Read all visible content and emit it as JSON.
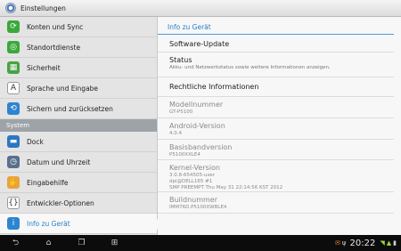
{
  "actionbar": {
    "title": "Einstellungen"
  },
  "sidebar": {
    "items_top": [
      {
        "label": "Konten und Sync",
        "icon": "sync-icon",
        "color": "#3aa83a",
        "glyph": "⟳"
      },
      {
        "label": "Standortdienste",
        "icon": "location-icon",
        "color": "#3aa83a",
        "glyph": "◎"
      },
      {
        "label": "Sicherheit",
        "icon": "security-grid-icon",
        "color": "#47a344",
        "glyph": "▦"
      },
      {
        "label": "Sprache und Eingabe",
        "icon": "language-icon",
        "color": "#ffffff",
        "glyph": "A"
      },
      {
        "label": "Sichern und zurücksetzen",
        "icon": "backup-icon",
        "color": "#2e84d0",
        "glyph": "⟲"
      }
    ],
    "section_header": "System",
    "items_bottom": [
      {
        "label": "Dock",
        "icon": "dock-icon",
        "color": "#2b78c0",
        "glyph": "▬"
      },
      {
        "label": "Datum und Uhrzeit",
        "icon": "clock-icon",
        "color": "#5a6f8c",
        "glyph": "◷"
      },
      {
        "label": "Eingabehilfe",
        "icon": "accessibility-hand-icon",
        "color": "#e9a33d",
        "glyph": "✋"
      },
      {
        "label": "Entwickler-Optionen",
        "icon": "developer-icon",
        "color": "#ffffff",
        "glyph": "{}"
      },
      {
        "label": "Info zu Gerät",
        "icon": "info-icon",
        "color": "#2e84d0",
        "glyph": "i"
      }
    ]
  },
  "content": {
    "header": "Info zu Gerät",
    "rows": [
      {
        "title": "Software-Update",
        "sub": "",
        "dim": false
      },
      {
        "title": "Status",
        "sub": "Akku- und Netzwerkstatus sowie weitere Informationen anzeigen.",
        "dim": false
      },
      {
        "title": "Rechtliche Informationen",
        "sub": "",
        "dim": false
      },
      {
        "title": "Modellnummer",
        "sub": "GT-P5100",
        "dim": true
      },
      {
        "title": "Android-Version",
        "sub": "4.0.4",
        "dim": true
      },
      {
        "title": "Basisbandversion",
        "sub": "P5100XXLE4",
        "dim": true
      },
      {
        "title": "Kernel-Version",
        "sub": "3.0.8-654505-user\ndpi@DELL165 #1\nSMP PREEMPT Thu May 31 22:14:56 KST 2012",
        "dim": true
      },
      {
        "title": "Buildnummer",
        "sub": "IMM76D.P5100XWBLE4",
        "dim": true
      }
    ]
  },
  "navbar": {
    "time": "20:22",
    "back_icon": "back-icon",
    "home_icon": "home-icon",
    "recent_icon": "recent-apps-icon",
    "screenshot_icon": "screenshot-icon"
  }
}
